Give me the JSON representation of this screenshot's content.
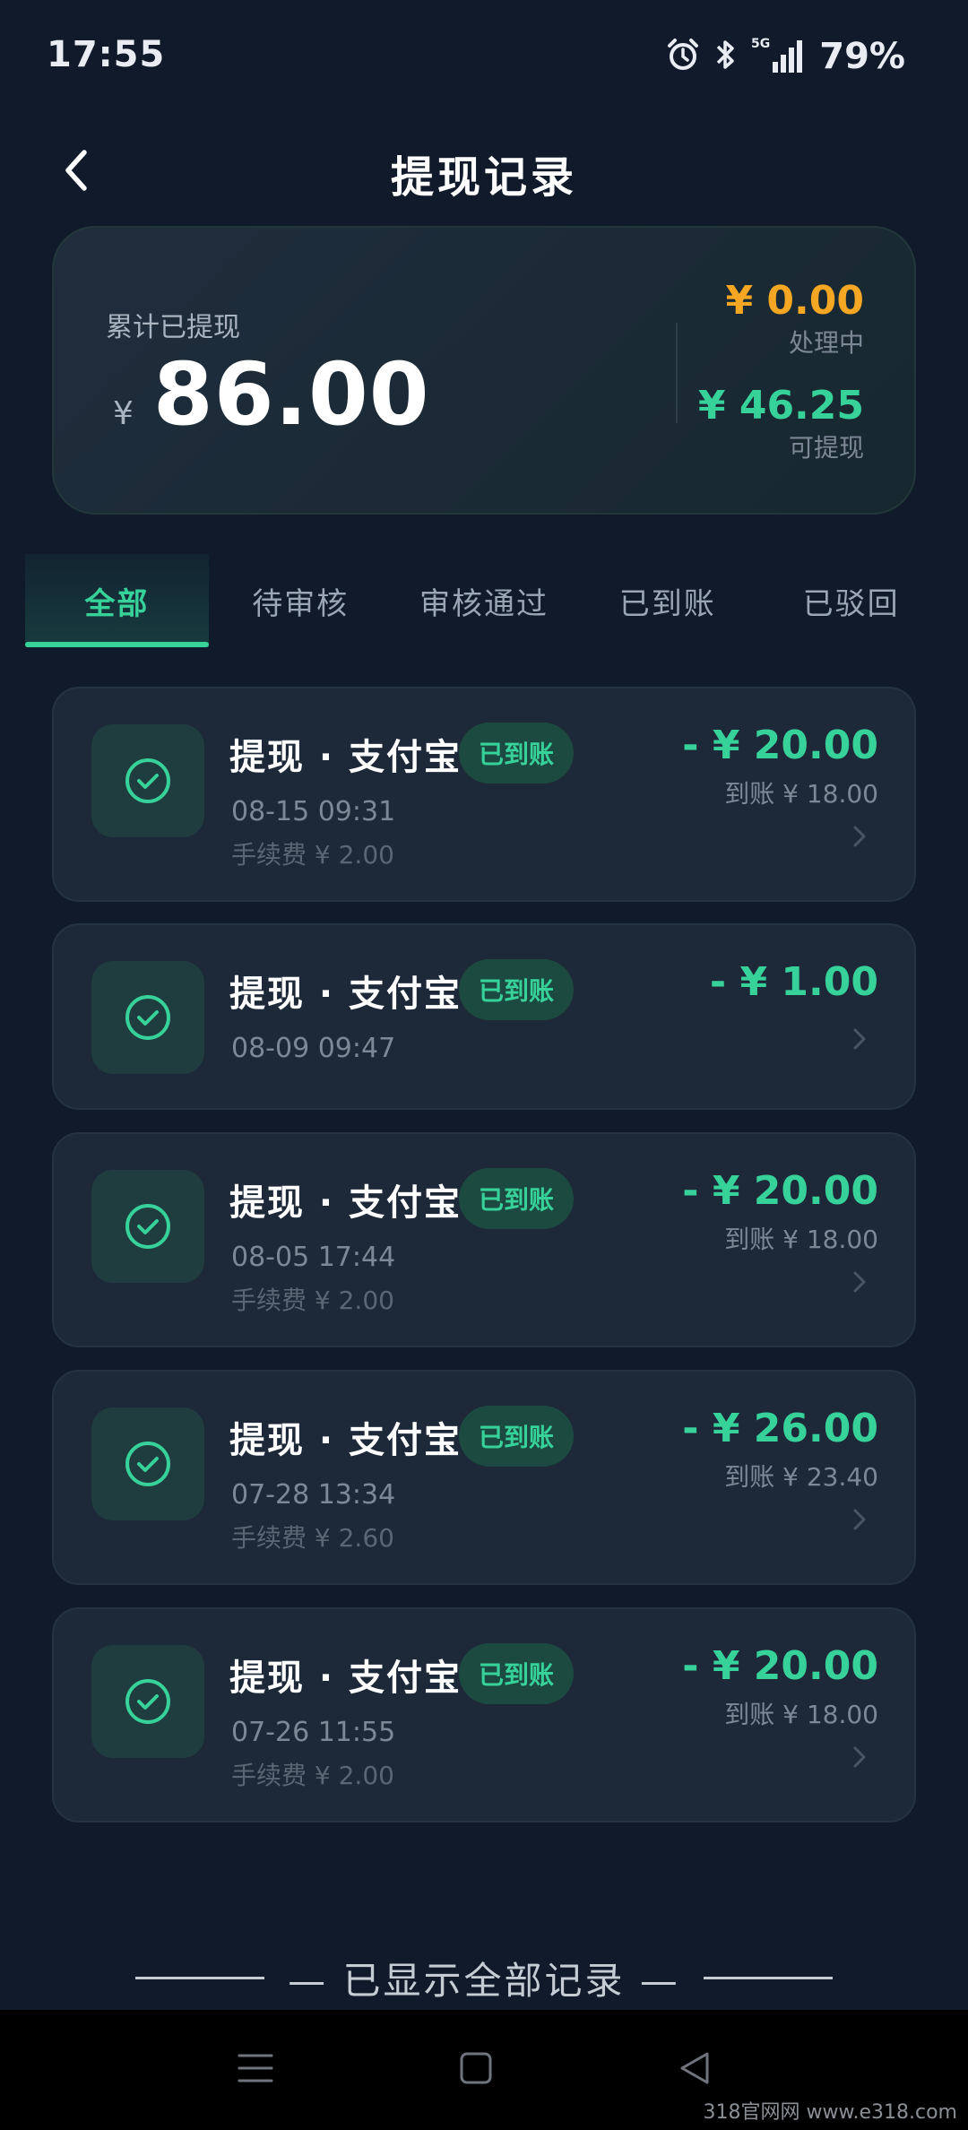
{
  "status_bar": {
    "time": "17:55",
    "network": "5G",
    "battery": "79%",
    "icons": [
      "alarm-icon",
      "bluetooth-icon",
      "signal-icon"
    ]
  },
  "header": {
    "title": "提现记录",
    "back_icon": "chevron-left-icon"
  },
  "summary": {
    "label": "累计已提现",
    "currency": "¥",
    "total": "86.00",
    "processing_amount": "¥ 0.00",
    "processing_label": "处理中",
    "available_amount": "¥ 46.25",
    "available_label": "可提现",
    "colors": {
      "processing": "#f5a623",
      "available": "#37d29a"
    }
  },
  "tabs": [
    {
      "label": "全部",
      "active": true
    },
    {
      "label": "待审核",
      "active": false
    },
    {
      "label": "审核通过",
      "active": false
    },
    {
      "label": "已到账",
      "active": false
    },
    {
      "label": "已驳回",
      "active": false
    }
  ],
  "records": [
    {
      "title": "提现 · 支付宝",
      "status": "已到账",
      "date": "08-15 09:31",
      "fee": "手续费 ¥ 2.00",
      "amount": "- ¥ 20.00",
      "received": "到账 ¥ 18.00"
    },
    {
      "title": "提现 · 支付宝",
      "status": "已到账",
      "date": "08-09 09:47",
      "fee": "",
      "amount": "- ¥ 1.00",
      "received": ""
    },
    {
      "title": "提现 · 支付宝",
      "status": "已到账",
      "date": "08-05 17:44",
      "fee": "手续费 ¥ 2.00",
      "amount": "- ¥ 20.00",
      "received": "到账 ¥ 18.00"
    },
    {
      "title": "提现 · 支付宝",
      "status": "已到账",
      "date": "07-28 13:34",
      "fee": "手续费 ¥ 2.60",
      "amount": "- ¥ 26.00",
      "received": "到账 ¥ 23.40"
    },
    {
      "title": "提现 · 支付宝",
      "status": "已到账",
      "date": "07-26 11:55",
      "fee": "手续费 ¥ 2.00",
      "amount": "- ¥ 20.00",
      "received": "到账 ¥ 18.00"
    }
  ],
  "footer": {
    "end_text": "— 已显示全部记录 —"
  },
  "nav_bar": {
    "icons": [
      "menu-icon",
      "home-square-icon",
      "back-triangle-icon"
    ]
  },
  "watermark": "318官网网 www.e318.com",
  "accent_color": "#37d29a"
}
